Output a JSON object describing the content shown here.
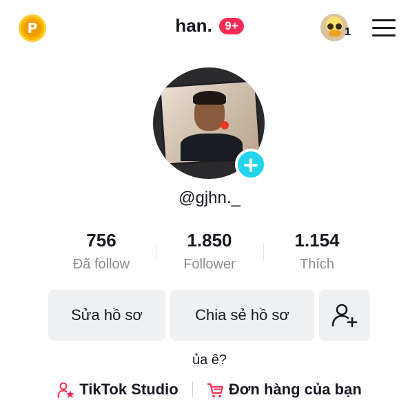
{
  "header": {
    "coin_icon": "P",
    "username": "han.",
    "notification_badge": "9+",
    "friends_count": "1"
  },
  "profile": {
    "handle": "@gjhn._",
    "bio": "ủa ê?"
  },
  "stats": [
    {
      "value": "756",
      "label": "Đã follow"
    },
    {
      "value": "1.850",
      "label": "Follower"
    },
    {
      "value": "1.154",
      "label": "Thích"
    }
  ],
  "actions": {
    "edit_profile": "Sửa hồ sơ",
    "share_profile": "Chia sẻ hồ sơ"
  },
  "links": {
    "studio": "TikTok Studio",
    "orders": "Đơn hàng của bạn"
  },
  "colors": {
    "accent_red": "#fe2c55",
    "add_button_cyan": "#20d5ec",
    "coin_gold": "#f7b500"
  }
}
